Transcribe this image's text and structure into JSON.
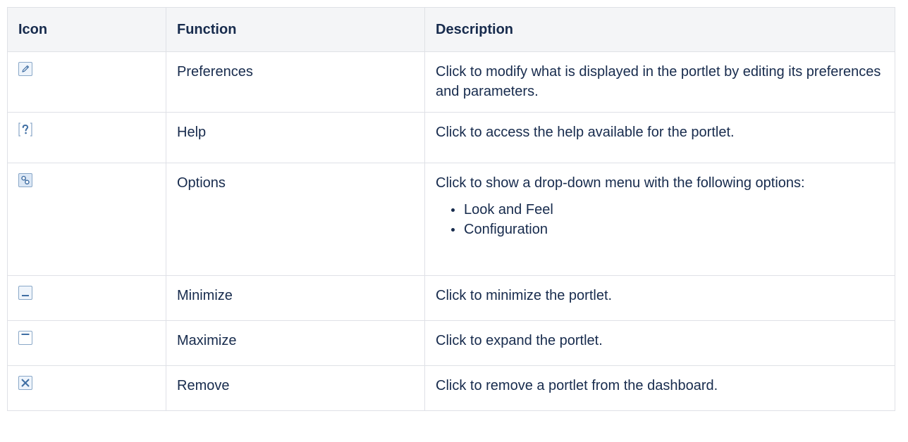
{
  "table": {
    "headers": {
      "icon": "Icon",
      "function": "Function",
      "description": "Description"
    },
    "rows": [
      {
        "icon": "pencil-icon",
        "function": "Preferences",
        "description": "Click to modify what is displayed in the portlet by editing its preferences and parameters."
      },
      {
        "icon": "question-mark-icon",
        "function": "Help",
        "description": "Click to access the help available for the portlet."
      },
      {
        "icon": "options-gear-icon",
        "function": "Options",
        "description": "Click to show a drop-down menu with the following options:",
        "list": [
          "Look and Feel",
          "Configuration"
        ]
      },
      {
        "icon": "minimize-icon",
        "function": "Minimize",
        "description": "Click to minimize the portlet."
      },
      {
        "icon": "maximize-icon",
        "function": "Maximize",
        "description": "Click to expand the portlet."
      },
      {
        "icon": "remove-x-icon",
        "function": "Remove",
        "description": "Click to remove a portlet from the dashboard."
      }
    ]
  },
  "colors": {
    "icon_border": "#8aa8c8",
    "icon_fill": "#eef4fb",
    "icon_glyph": "#3f6ea3",
    "header_bg": "#f4f5f7",
    "grid": "#dfe1e6",
    "text": "#172b4d"
  }
}
